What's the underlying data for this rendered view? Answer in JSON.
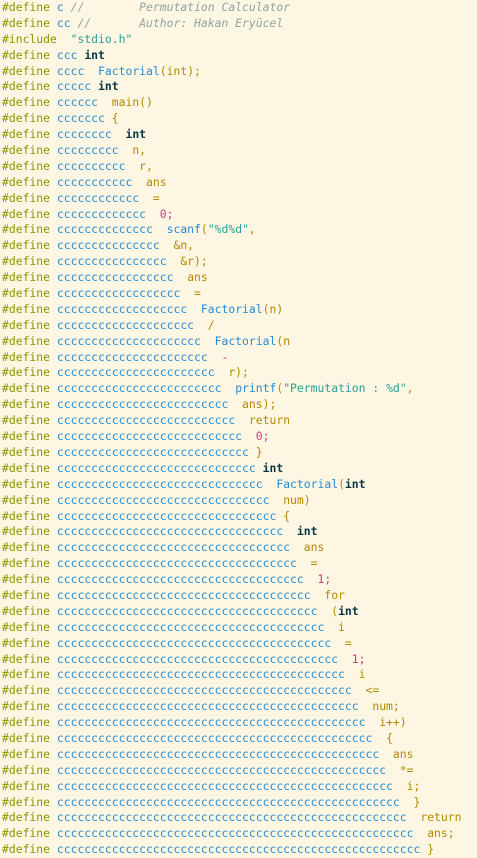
{
  "editor": {
    "lines": [
      {
        "directive": "#define",
        "name": "c",
        "gap": " ",
        "value": "//        Permutation Calculator",
        "type": "comment"
      },
      {
        "directive": "#define",
        "name": "cc",
        "gap": " ",
        "value": "//       Author: Hakan Eryücel",
        "type": "comment"
      },
      {
        "directive": "#include",
        "name": "",
        "gap": " ",
        "value": "\"stdio.h\"",
        "type": "str"
      },
      {
        "directive": "#define",
        "name": "ccc",
        "gap": " ",
        "value": "int",
        "type": "kw"
      },
      {
        "directive": "#define",
        "name": "cccc",
        "gap": "  ",
        "value": "Factorial(int);",
        "type": "fn"
      },
      {
        "directive": "#define",
        "name": "ccccc",
        "gap": " ",
        "value": "int",
        "type": "kw"
      },
      {
        "directive": "#define",
        "name": "cccccc",
        "gap": "  ",
        "value": "main()",
        "type": "val"
      },
      {
        "directive": "#define",
        "name": "ccccccc",
        "gap": " ",
        "value": "{",
        "type": "val"
      },
      {
        "directive": "#define",
        "name": "cccccccc",
        "gap": "  ",
        "value": "int",
        "type": "kw"
      },
      {
        "directive": "#define",
        "name": "ccccccccc",
        "gap": "  ",
        "value": "n,",
        "type": "val"
      },
      {
        "directive": "#define",
        "name": "cccccccccc",
        "gap": "  ",
        "value": "r,",
        "type": "val"
      },
      {
        "directive": "#define",
        "name": "ccccccccccc",
        "gap": "  ",
        "value": "ans",
        "type": "val"
      },
      {
        "directive": "#define",
        "name": "cccccccccccc",
        "gap": "  ",
        "value": "=",
        "type": "val"
      },
      {
        "directive": "#define",
        "name": "ccccccccccccc",
        "gap": "  ",
        "value": "0;",
        "type": "num"
      },
      {
        "directive": "#define",
        "name": "cccccccccccccc",
        "gap": "  ",
        "value": "scanf(\"%d%d\",",
        "type": "scanf"
      },
      {
        "directive": "#define",
        "name": "ccccccccccccccc",
        "gap": "  ",
        "value": "&n,",
        "type": "val"
      },
      {
        "directive": "#define",
        "name": "cccccccccccccccc",
        "gap": "  ",
        "value": "&r);",
        "type": "val"
      },
      {
        "directive": "#define",
        "name": "ccccccccccccccccc",
        "gap": "  ",
        "value": "ans",
        "type": "val"
      },
      {
        "directive": "#define",
        "name": "cccccccccccccccccc",
        "gap": "  ",
        "value": "=",
        "type": "val"
      },
      {
        "directive": "#define",
        "name": "ccccccccccccccccccc",
        "gap": "  ",
        "value": "Factorial(n)",
        "type": "fn"
      },
      {
        "directive": "#define",
        "name": "cccccccccccccccccccc",
        "gap": "  ",
        "value": "/",
        "type": "val"
      },
      {
        "directive": "#define",
        "name": "ccccccccccccccccccccc",
        "gap": "  ",
        "value": "Factorial(n",
        "type": "fn"
      },
      {
        "directive": "#define",
        "name": "cccccccccccccccccccccc",
        "gap": "  ",
        "value": "-",
        "type": "num"
      },
      {
        "directive": "#define",
        "name": "ccccccccccccccccccccccc",
        "gap": "  ",
        "value": "r);",
        "type": "val"
      },
      {
        "directive": "#define",
        "name": "cccccccccccccccccccccccc",
        "gap": "  ",
        "value": "printf(\"Permutation : %d\",",
        "type": "printf"
      },
      {
        "directive": "#define",
        "name": "ccccccccccccccccccccccccc",
        "gap": "  ",
        "value": "ans);",
        "type": "val"
      },
      {
        "directive": "#define",
        "name": "cccccccccccccccccccccccccc",
        "gap": "  ",
        "value": "return",
        "type": "val"
      },
      {
        "directive": "#define",
        "name": "ccccccccccccccccccccccccccc",
        "gap": "  ",
        "value": "0;",
        "type": "num"
      },
      {
        "directive": "#define",
        "name": "cccccccccccccccccccccccccccc",
        "gap": " ",
        "value": "}",
        "type": "val"
      },
      {
        "directive": "#define",
        "name": "ccccccccccccccccccccccccccccc",
        "gap": " ",
        "value": "int",
        "type": "kw"
      },
      {
        "directive": "#define",
        "name": "cccccccccccccccccccccccccccccc",
        "gap": "  ",
        "value": "Factorial(int",
        "type": "fnkw"
      },
      {
        "directive": "#define",
        "name": "ccccccccccccccccccccccccccccccc",
        "gap": "  ",
        "value": "num)",
        "type": "val"
      },
      {
        "directive": "#define",
        "name": "cccccccccccccccccccccccccccccccc",
        "gap": " ",
        "value": "{",
        "type": "val"
      },
      {
        "directive": "#define",
        "name": "ccccccccccccccccccccccccccccccccc",
        "gap": "  ",
        "value": "int",
        "type": "kw"
      },
      {
        "directive": "#define",
        "name": "cccccccccccccccccccccccccccccccccc",
        "gap": "  ",
        "value": "ans",
        "type": "val"
      },
      {
        "directive": "#define",
        "name": "ccccccccccccccccccccccccccccccccccc",
        "gap": "  ",
        "value": "=",
        "type": "val"
      },
      {
        "directive": "#define",
        "name": "cccccccccccccccccccccccccccccccccccc",
        "gap": "  ",
        "value": "1;",
        "type": "num"
      },
      {
        "directive": "#define",
        "name": "ccccccccccccccccccccccccccccccccccccc",
        "gap": "  ",
        "value": "for",
        "type": "val"
      },
      {
        "directive": "#define",
        "name": "cccccccccccccccccccccccccccccccccccccc",
        "gap": "  ",
        "value": "(int",
        "type": "parkw"
      },
      {
        "directive": "#define",
        "name": "ccccccccccccccccccccccccccccccccccccccc",
        "gap": "  ",
        "value": "i",
        "type": "val"
      },
      {
        "directive": "#define",
        "name": "cccccccccccccccccccccccccccccccccccccccc",
        "gap": "  ",
        "value": "=",
        "type": "val"
      },
      {
        "directive": "#define",
        "name": "ccccccccccccccccccccccccccccccccccccccccc",
        "gap": "  ",
        "value": "1;",
        "type": "num"
      },
      {
        "directive": "#define",
        "name": "cccccccccccccccccccccccccccccccccccccccccc",
        "gap": "  ",
        "value": "i",
        "type": "val"
      },
      {
        "directive": "#define",
        "name": "ccccccccccccccccccccccccccccccccccccccccccc",
        "gap": "  ",
        "value": "<=",
        "type": "val"
      },
      {
        "directive": "#define",
        "name": "cccccccccccccccccccccccccccccccccccccccccccc",
        "gap": "  ",
        "value": "num;",
        "type": "val"
      },
      {
        "directive": "#define",
        "name": "ccccccccccccccccccccccccccccccccccccccccccccc",
        "gap": "  ",
        "value": "i++)",
        "type": "val"
      },
      {
        "directive": "#define",
        "name": "cccccccccccccccccccccccccccccccccccccccccccccc",
        "gap": "  ",
        "value": "{",
        "type": "val"
      },
      {
        "directive": "#define",
        "name": "ccccccccccccccccccccccccccccccccccccccccccccccc",
        "gap": "  ",
        "value": "ans",
        "type": "val"
      },
      {
        "directive": "#define",
        "name": "cccccccccccccccccccccccccccccccccccccccccccccccc",
        "gap": "  ",
        "value": "*=",
        "type": "val"
      },
      {
        "directive": "#define",
        "name": "ccccccccccccccccccccccccccccccccccccccccccccccccc",
        "gap": "  ",
        "value": "i;",
        "type": "val"
      },
      {
        "directive": "#define",
        "name": "cccccccccccccccccccccccccccccccccccccccccccccccccc",
        "gap": "  ",
        "value": "}",
        "type": "val"
      },
      {
        "directive": "#define",
        "name": "ccccccccccccccccccccccccccccccccccccccccccccccccccc",
        "gap": "  ",
        "value": "return",
        "type": "val"
      },
      {
        "directive": "#define",
        "name": "cccccccccccccccccccccccccccccccccccccccccccccccccccc",
        "gap": "  ",
        "value": "ans;",
        "type": "val"
      },
      {
        "directive": "#define",
        "name": "ccccccccccccccccccccccccccccccccccccccccccccccccccccc",
        "gap": " ",
        "value": "}",
        "type": "val"
      }
    ]
  },
  "colors": {
    "background": "#fdf6e3",
    "directive": "#859900",
    "macro": "#268bd2",
    "value": "#b58900",
    "keyword": "#073642",
    "string": "#2aa198",
    "number": "#d33682",
    "comment": "#93a1a1"
  }
}
